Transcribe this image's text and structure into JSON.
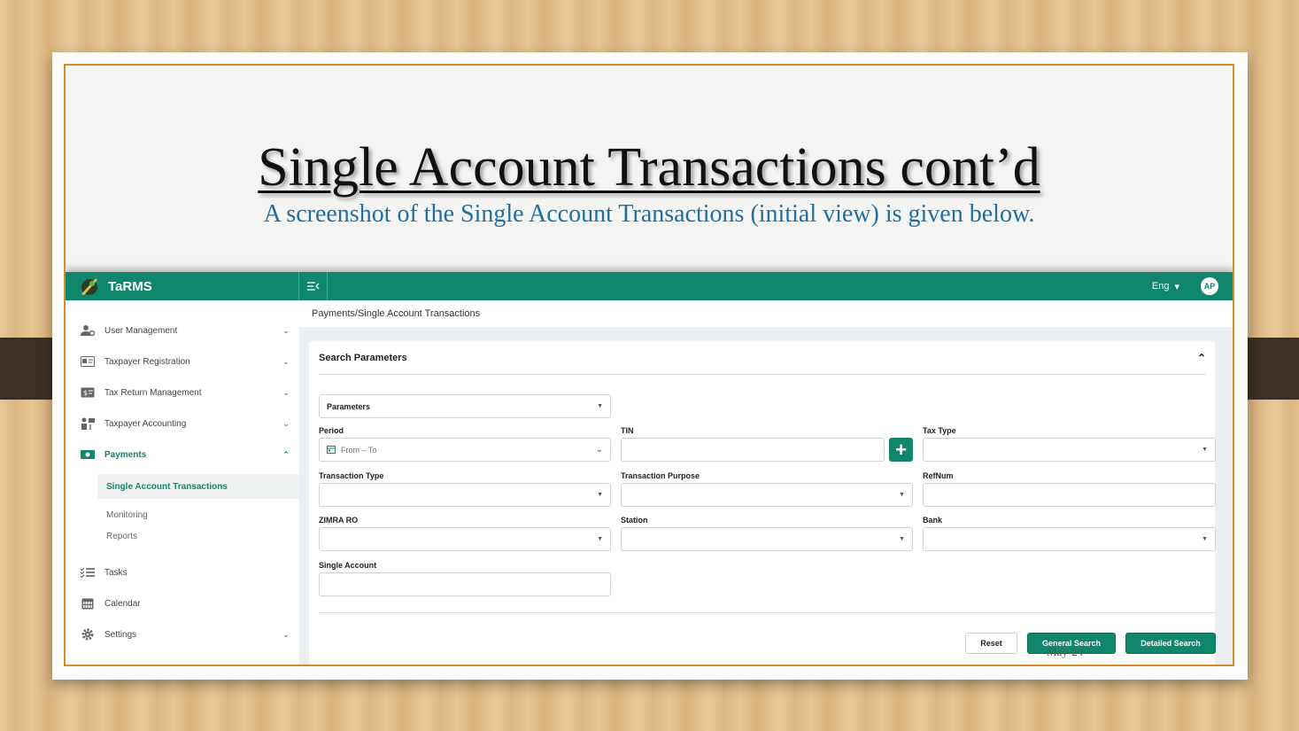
{
  "slide": {
    "title": "Single Account Transactions cont’d",
    "subtitle": "A screenshot of the Single Account Transactions (initial view) is given below.",
    "date": "May-24"
  },
  "app": {
    "brand": "TaRMS",
    "language": "Eng",
    "avatar_initials": "AP",
    "accent_color": "#10876d"
  },
  "sidebar": {
    "items": [
      {
        "label": "User Management",
        "icon": "user-gear-icon"
      },
      {
        "label": "Taxpayer Registration",
        "icon": "id-card-icon"
      },
      {
        "label": "Tax Return Management",
        "icon": "money-card-icon"
      },
      {
        "label": "Taxpayer Accounting",
        "icon": "accounting-icon"
      },
      {
        "label": "Payments",
        "icon": "cash-icon"
      },
      {
        "label": "Tasks",
        "icon": "checklist-icon"
      },
      {
        "label": "Calendar",
        "icon": "calendar-icon"
      },
      {
        "label": "Settings",
        "icon": "gear-icon"
      }
    ],
    "sub_items": [
      "Single Account Transactions",
      "Monitoring",
      "Reports"
    ]
  },
  "main": {
    "breadcrumb": "Payments/Single Account Transactions",
    "panel_title": "Search Parameters",
    "parameters_select": "Parameters",
    "fields": {
      "period_label": "Period",
      "period_value": "From – To",
      "tin_label": "TIN",
      "tax_type_label": "Tax Type",
      "transaction_type_label": "Transaction Type",
      "transaction_purpose_label": "Transaction Purpose",
      "refnum_label": "RefNum",
      "zimra_ro_label": "ZIMRA RO",
      "station_label": "Station",
      "bank_label": "Bank",
      "single_account_label": "Single Account"
    },
    "buttons": {
      "reset": "Reset",
      "general_search": "General Search",
      "detailed_search": "Detailed Search"
    }
  }
}
